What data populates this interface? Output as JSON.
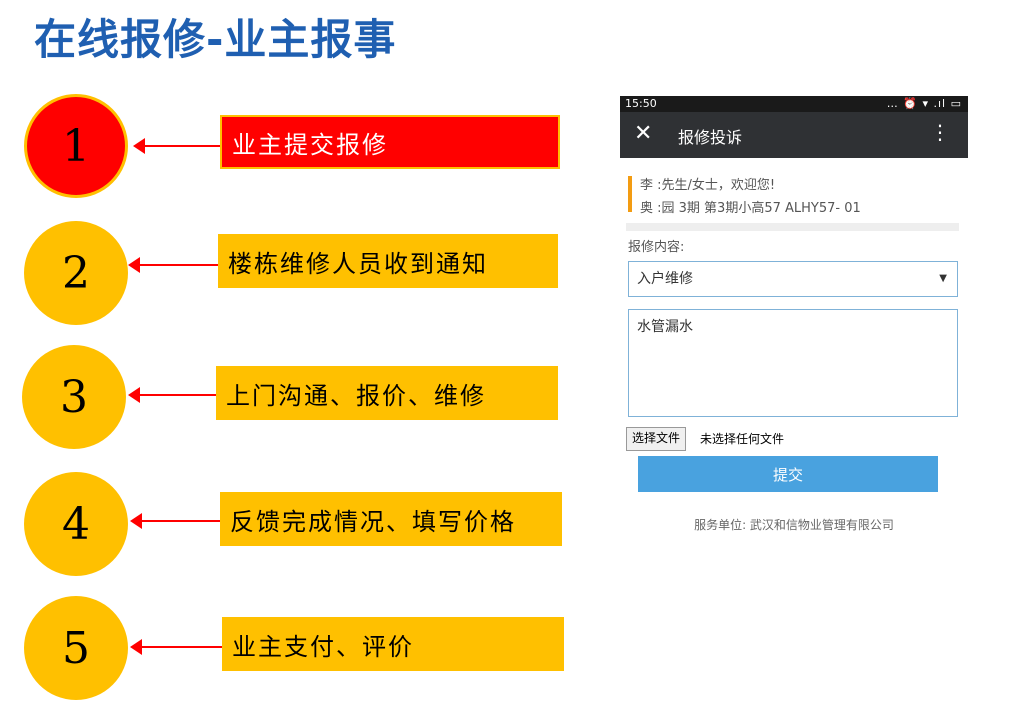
{
  "slide_title": "在线报修-业主报事",
  "steps": [
    {
      "number": "1",
      "label": "业主提交报修"
    },
    {
      "number": "2",
      "label": "楼栋维修人员收到通知"
    },
    {
      "number": "3",
      "label": "上门沟通、报价、维修"
    },
    {
      "number": "4",
      "label": "反馈完成情况、填写价格"
    },
    {
      "number": "5",
      "label": "业主支付、评价"
    }
  ],
  "phone": {
    "status_time": "15:50",
    "status_icons": "… ⏰ ▾ .ıl ▭",
    "app_title": "报修投诉",
    "close_glyph": "✕",
    "more_glyph": "⋮",
    "user_line1": "李     :先生/女士，欢迎您!",
    "user_line2": "奥     :园 3期 第3期小高57 ALHY57-         01",
    "content_label": "报修内容:",
    "category_value": "入户维修",
    "caret_glyph": "▼",
    "description_value": "水管漏水",
    "file_button": "选择文件",
    "file_status": "未选择任何文件",
    "submit_label": "提交",
    "footer": "服务单位: 武汉和信物业管理有限公司"
  },
  "colors": {
    "title": "#1f5fb1",
    "step_yellow": "#ffc000",
    "step_red": "#ff0000",
    "submit_blue": "#49a2df",
    "app_bar": "#2f3134"
  }
}
